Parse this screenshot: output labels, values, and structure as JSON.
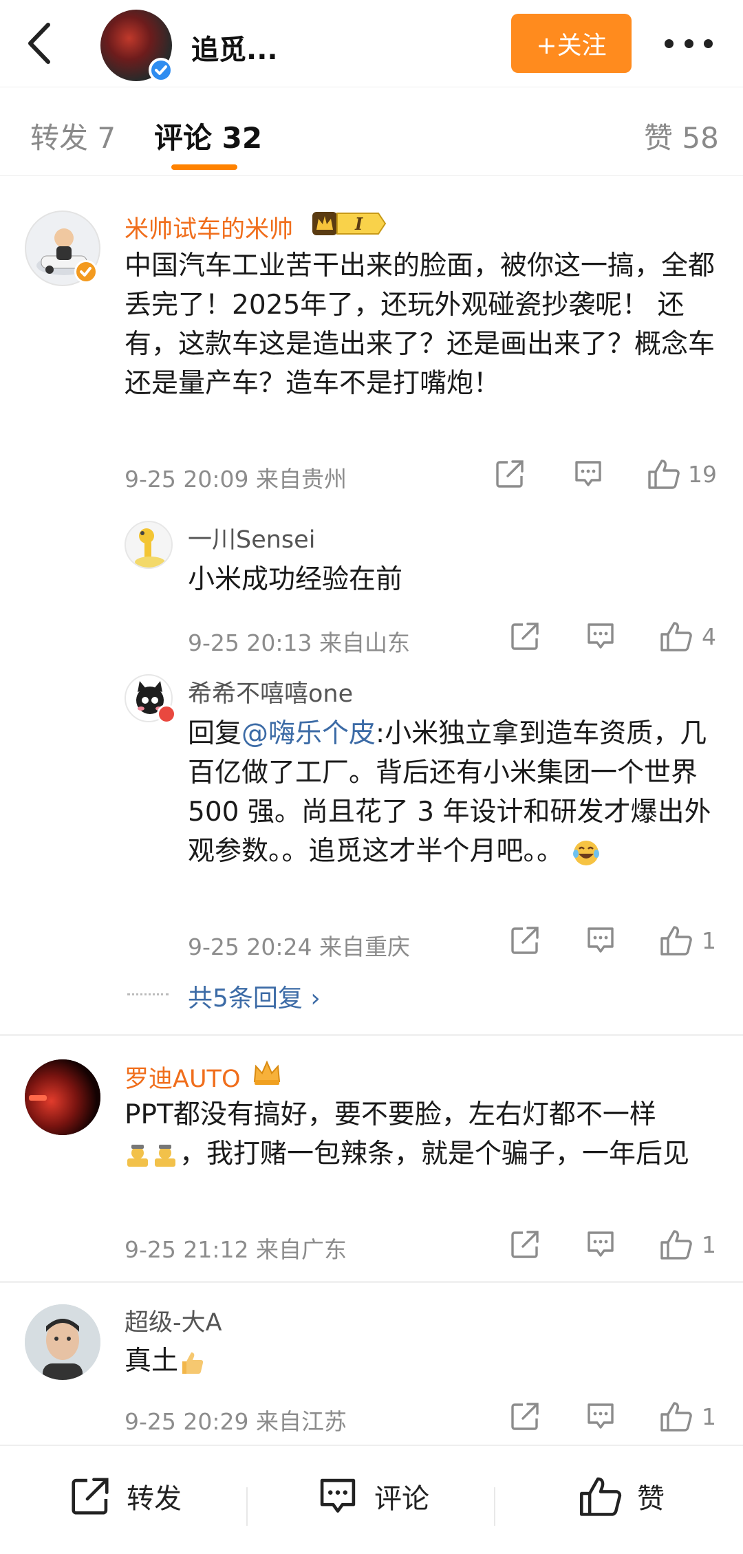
{
  "header": {
    "title": "追觅...",
    "follow_label": "+关注"
  },
  "tabs": {
    "repost": "转发 7",
    "comments": "评论 32",
    "likes": "赞 58"
  },
  "comments": [
    {
      "username": "米帅试车的米帅",
      "text": "中国汽车工业苦干出来的脸面，被你这一搞，全都丢完了！2025年了，还玩外观碰瓷抄袭呢！  还有，这款车这是造出来了？还是画出来了？概念车还是量产车？造车不是打嘴炮！",
      "meta": "9-25 20:09  来自贵州",
      "likes": "19",
      "badge": "I"
    },
    {
      "username": "一川Sensei",
      "text": "小米成功经验在前",
      "meta": "9-25 20:13  来自山东",
      "likes": "4"
    },
    {
      "username": "希希不嘻嘻one",
      "reply_prefix": "回复",
      "mention": "@嗨乐个皮",
      "text": ":小米独立拿到造车资质，几百亿做了工厂。背后还有小米集团一个世界 500 强。尚且花了 3 年设计和研发才爆出外观参数。。追觅这才半个月吧。。",
      "meta": "9-25 20:24  来自重庆",
      "likes": "1"
    },
    {
      "username": "罗迪AUTO",
      "text_a": "PPT都没有搞好，要不要脸，左右灯都不一样",
      "text_b": "，我打赌一包辣条，就是个骗子，一年后见",
      "meta": "9-25 21:12  来自广东",
      "likes": "1"
    },
    {
      "username": "超级-大A",
      "text": "真土",
      "meta": "9-25 20:29  来自江苏",
      "likes": "1"
    }
  ],
  "more_replies": "共5条回复 ›",
  "bottom_bar": {
    "repost": "转发",
    "comment": "评论",
    "like": "赞"
  }
}
